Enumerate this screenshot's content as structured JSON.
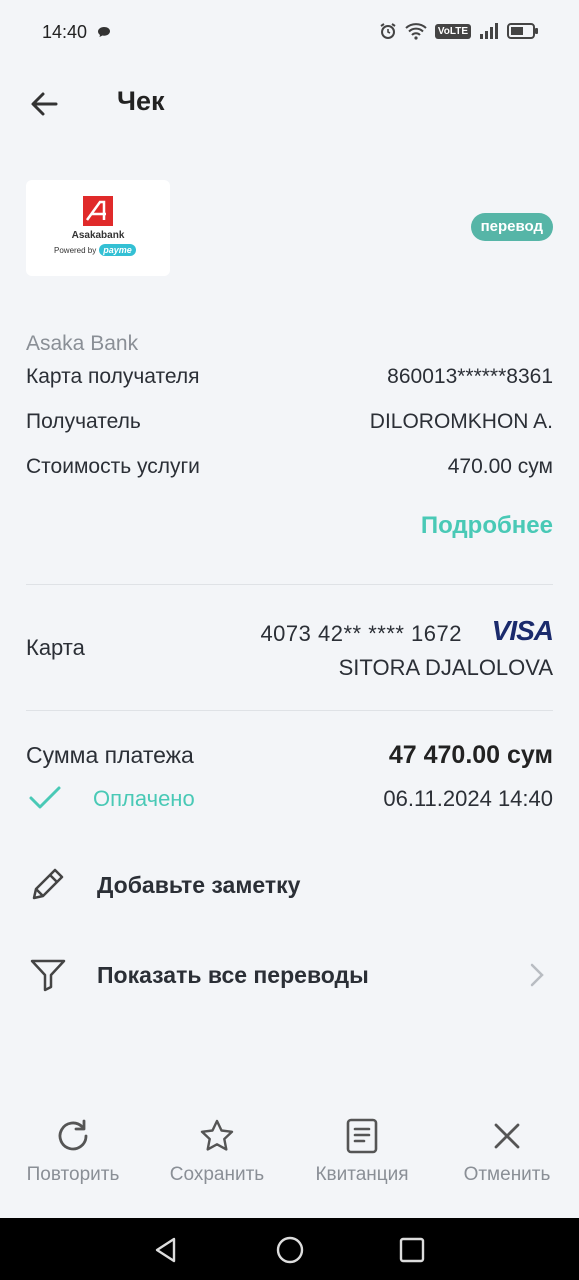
{
  "status": {
    "time": "14:40",
    "volte": "VoLTE"
  },
  "header": {
    "title": "Чек"
  },
  "logo": {
    "name": "Asakabank",
    "powered": "Powered by",
    "payme": "payme"
  },
  "badge": "перевод",
  "details": {
    "bank": "Asaka Bank",
    "rows": [
      {
        "label": "Карта получателя",
        "value": "860013******8361"
      },
      {
        "label": "Получатель",
        "value": "DILOROMKHON A."
      },
      {
        "label": "Стоимость услуги",
        "value": "470.00 сум"
      }
    ],
    "more": "Подробнее"
  },
  "card": {
    "label": "Карта",
    "number": "4073 42** **** 1672",
    "brand": "VISA",
    "holder": "SITORA DJALOLOVA"
  },
  "payment": {
    "label": "Сумма платежа",
    "amount": "47 470.00 сум",
    "status": "Оплачено",
    "datetime": "06.11.2024 14:40"
  },
  "actions": {
    "note": "Добавьте заметку",
    "transfers": "Показать все переводы"
  },
  "toolbar": {
    "repeat": "Повторить",
    "save": "Сохранить",
    "receipt": "Квитанция",
    "cancel": "Отменить"
  },
  "colors": {
    "accent": "#49c9b6",
    "badge": "#56b5a7",
    "background": "#f3f5f8",
    "visa": "#1a2a6c"
  }
}
